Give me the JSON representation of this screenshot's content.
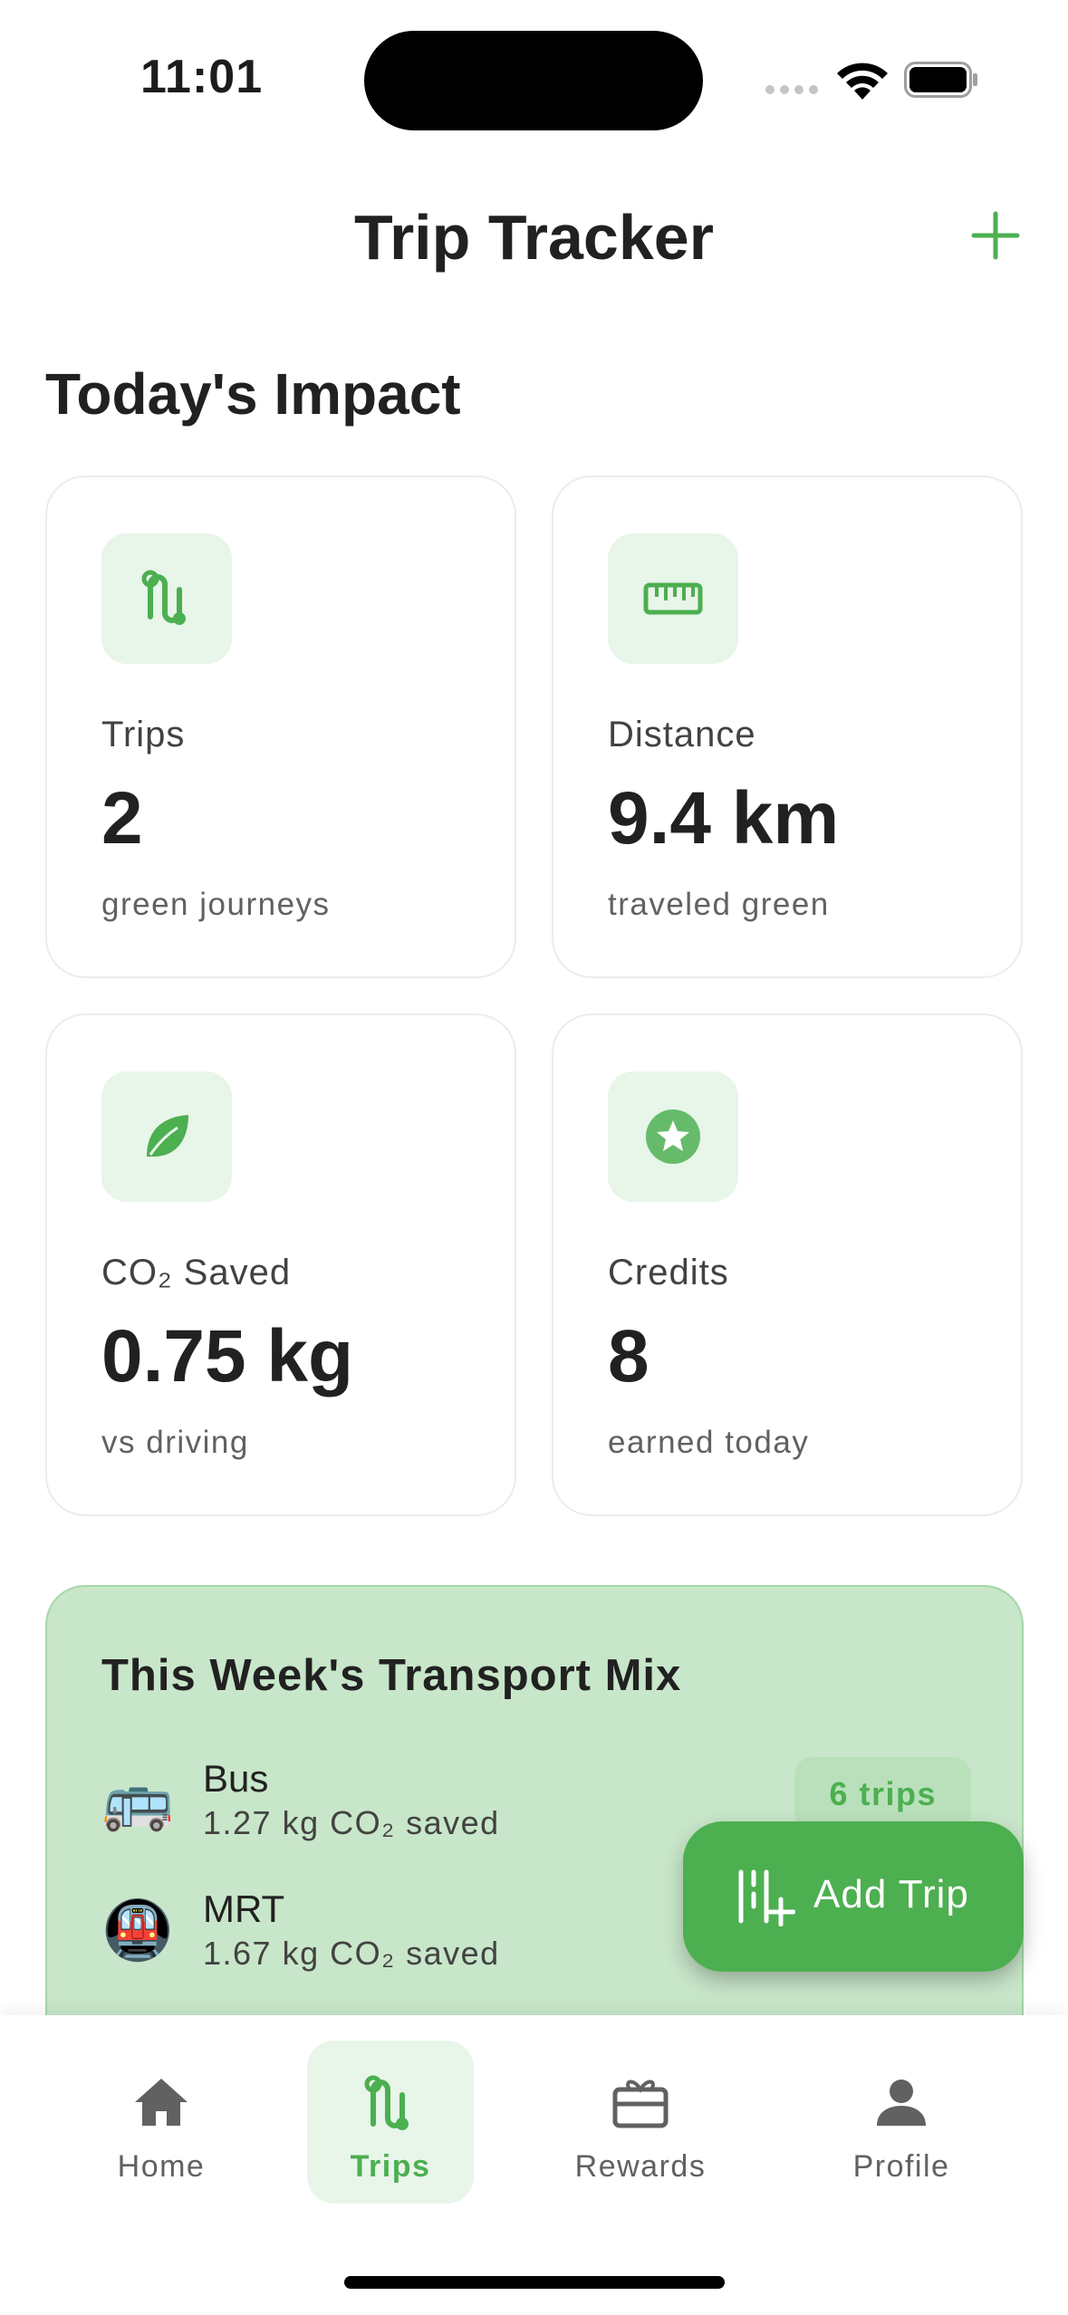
{
  "status_bar": {
    "time": "11:01"
  },
  "header": {
    "title": "Trip Tracker"
  },
  "section": {
    "title": "Today's Impact"
  },
  "cards": [
    {
      "label": "Trips",
      "value": "2",
      "sub": "green journeys",
      "icon": "route-icon"
    },
    {
      "label": "Distance",
      "value": "9.4 km",
      "sub": "traveled green",
      "icon": "ruler-icon"
    },
    {
      "label": "CO₂ Saved",
      "value": "0.75 kg",
      "sub": "vs driving",
      "icon": "leaf-icon"
    },
    {
      "label": "Credits",
      "value": "8",
      "sub": "earned today",
      "icon": "star-badge-icon"
    }
  ],
  "transport_mix": {
    "title": "This Week's Transport Mix",
    "items": [
      {
        "name": "Bus",
        "saved": "1.27 kg CO₂ saved",
        "badge": "6 trips",
        "icon": "🚌"
      },
      {
        "name": "MRT",
        "saved": "1.67 kg CO₂ saved",
        "badge": "",
        "icon": "🚇"
      }
    ]
  },
  "fab": {
    "label": "Add Trip"
  },
  "nav": {
    "items": [
      {
        "label": "Home"
      },
      {
        "label": "Trips"
      },
      {
        "label": "Rewards"
      },
      {
        "label": "Profile"
      }
    ],
    "active": "Trips"
  },
  "colors": {
    "accent": "#4caf50",
    "accent_light": "#e8f5e9",
    "mix_bg": "#c8e6c9"
  }
}
